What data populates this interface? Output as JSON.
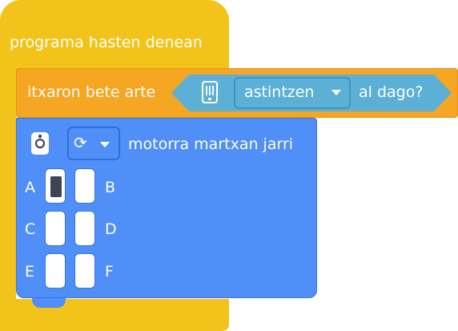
{
  "event_block": {
    "label": "programa hasten denean",
    "color": "#f2c31a"
  },
  "wait_block": {
    "label": "itxaron bete arte",
    "color": "#f5a623",
    "condition": {
      "device_icon": "brain-device-icon",
      "selected_option": "astintzen",
      "suffix": "al dago?",
      "color": "#5cb0d6"
    }
  },
  "motor_block": {
    "action": "motorra martxan jarri",
    "color": "#4f8ff7",
    "device_icon": "motor-icon",
    "direction_icon": "rotate-icon",
    "ports": [
      {
        "letter": "A",
        "selected": true
      },
      {
        "letter": "B",
        "selected": false
      },
      {
        "letter": "C",
        "selected": false
      },
      {
        "letter": "D",
        "selected": false
      },
      {
        "letter": "E",
        "selected": false
      },
      {
        "letter": "F",
        "selected": false
      }
    ]
  }
}
